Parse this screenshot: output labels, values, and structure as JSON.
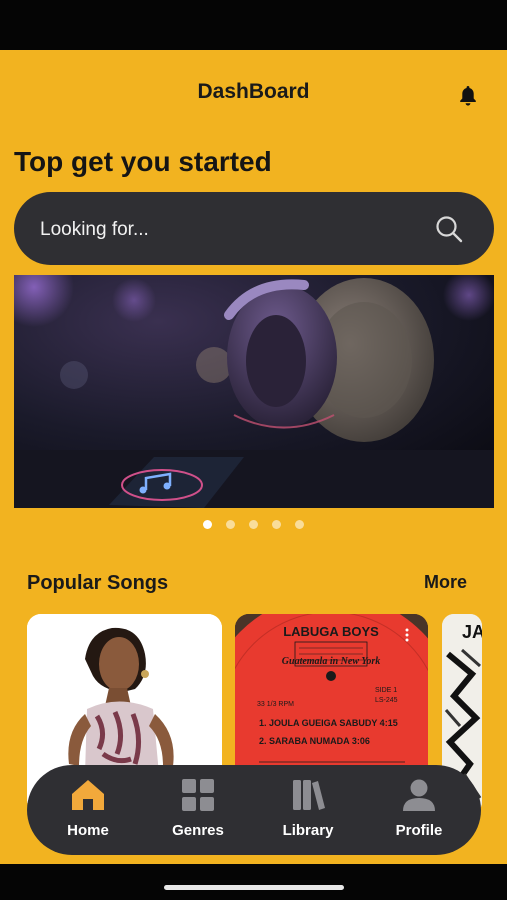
{
  "header": {
    "title": "DashBoard"
  },
  "hero": {
    "heading": "Top get you started"
  },
  "search": {
    "placeholder": "Looking for..."
  },
  "carousel": {
    "slides": 5,
    "active_index": 0
  },
  "popular": {
    "title": "Popular Songs",
    "more_label": "More"
  },
  "album_cards": [
    {
      "art_text": ""
    },
    {
      "label_line1": "LABUGA BOYS",
      "label_line2": "Guatemala in New York",
      "side": "SIDE 1",
      "rpm": "33 1/3 RPM",
      "catalog": "LS-245",
      "track1": "1. JOULA GUEIGA SABUDY 4:15",
      "track2": "2. SARABA NUMADA 3:06"
    },
    {
      "art_text": "JA"
    }
  ],
  "nav": {
    "items": [
      {
        "label": "Home",
        "icon": "home-icon",
        "active": true
      },
      {
        "label": "Genres",
        "icon": "grid-icon",
        "active": false
      },
      {
        "label": "Library",
        "icon": "library-icon",
        "active": false
      },
      {
        "label": "Profile",
        "icon": "profile-icon",
        "active": false
      }
    ]
  },
  "colors": {
    "background": "#f2b320",
    "dark_surface": "#2f2f33",
    "active_icon": "#f2a93b",
    "inactive_icon": "#8d8d92"
  }
}
